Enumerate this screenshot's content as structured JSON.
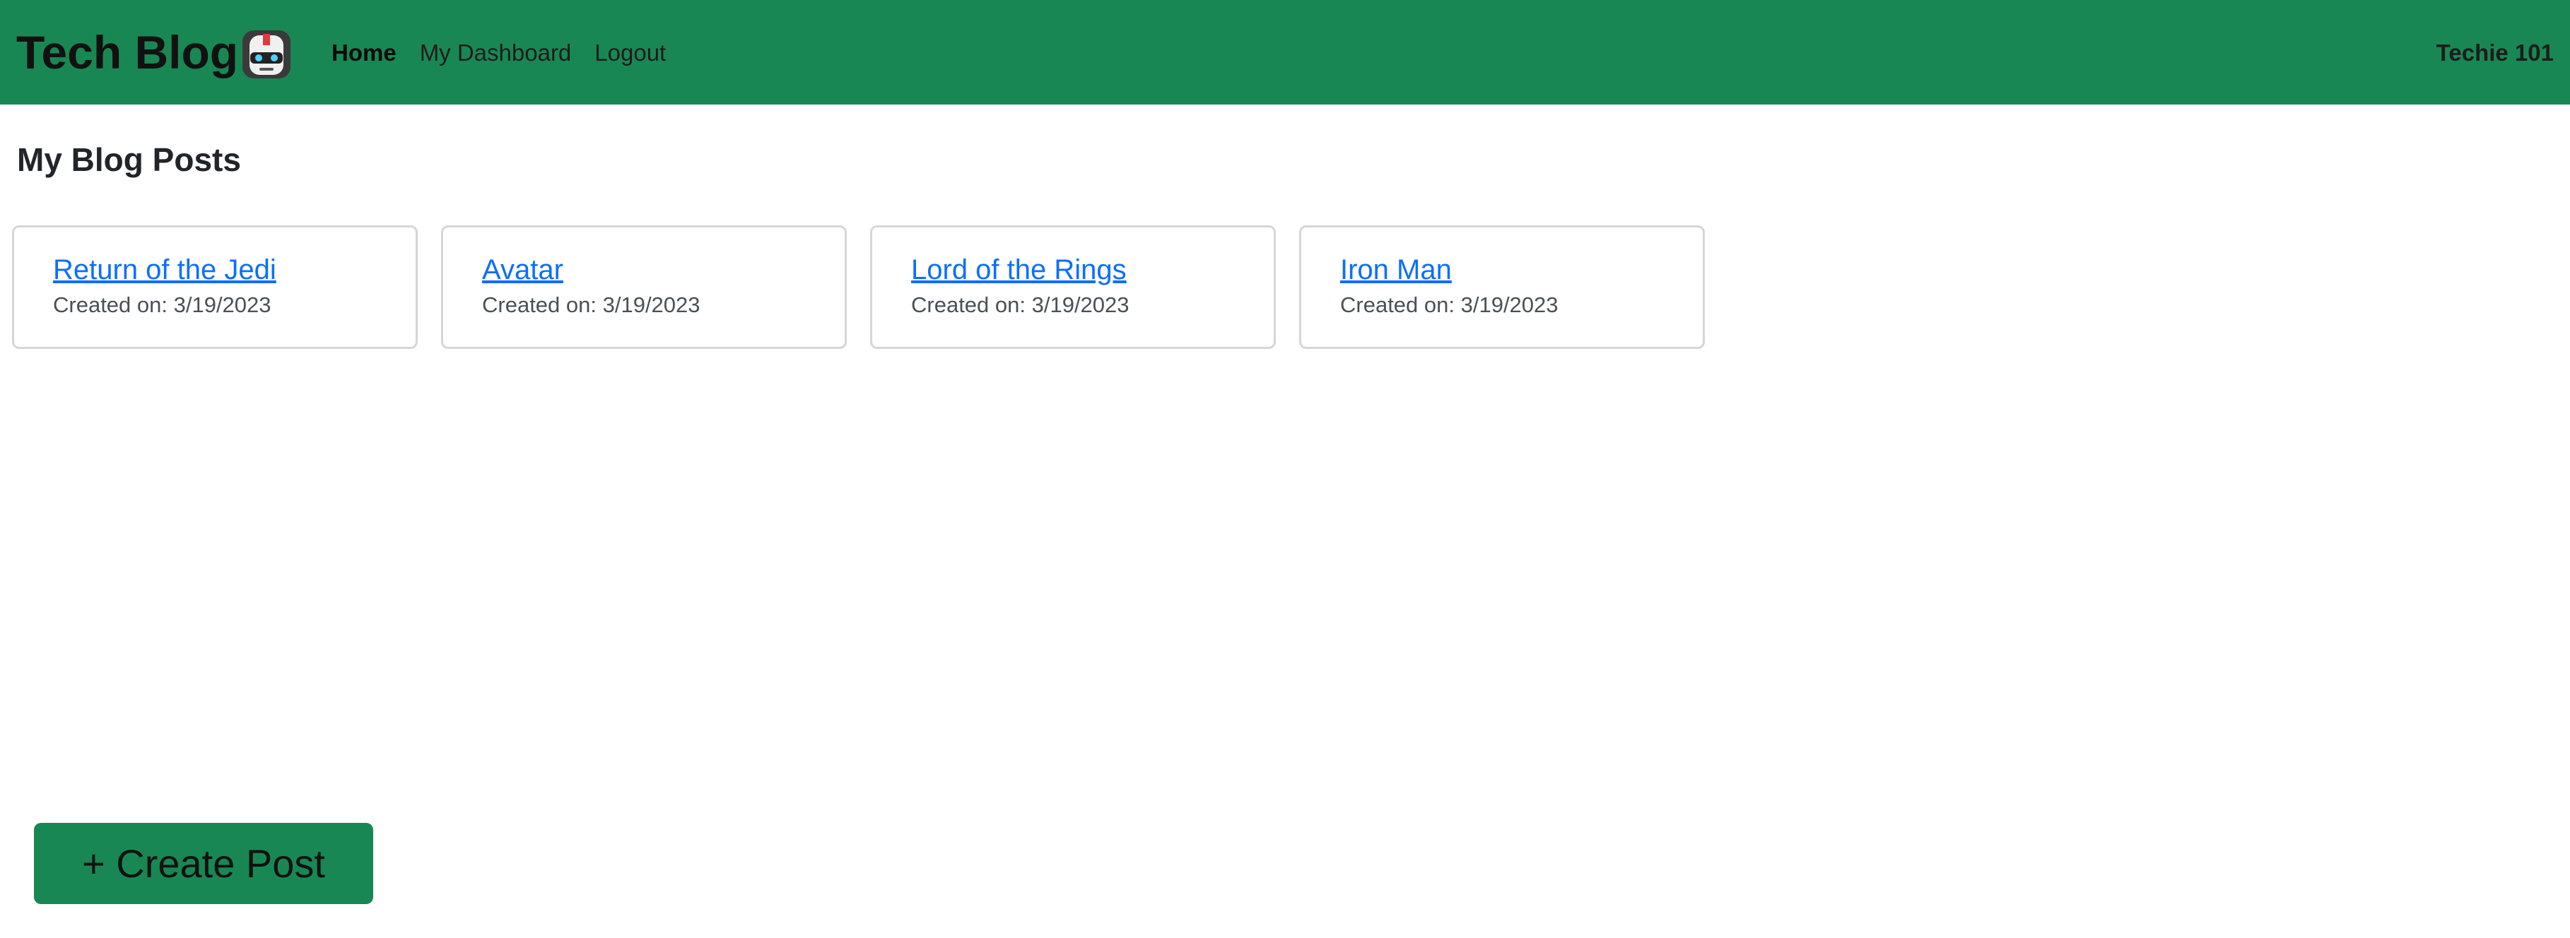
{
  "navbar": {
    "brand": "Tech Blog",
    "logo_icon": "robot-icon",
    "links": [
      {
        "label": "Home",
        "active": true
      },
      {
        "label": "My Dashboard",
        "active": false
      },
      {
        "label": "Logout",
        "active": false
      }
    ],
    "username": "Techie 101",
    "color": "#198754"
  },
  "main": {
    "title": "My Blog Posts",
    "posts": [
      {
        "title": "Return of the Jedi",
        "created": "Created on: 3/19/2023"
      },
      {
        "title": "Avatar",
        "created": "Created on: 3/19/2023"
      },
      {
        "title": "Lord of the Rings",
        "created": "Created on: 3/19/2023"
      },
      {
        "title": "Iron Man",
        "created": "Created on: 3/19/2023"
      }
    ],
    "create_button": "+ Create Post"
  },
  "colors": {
    "accent": "#198754",
    "link": "#0d6efd"
  }
}
